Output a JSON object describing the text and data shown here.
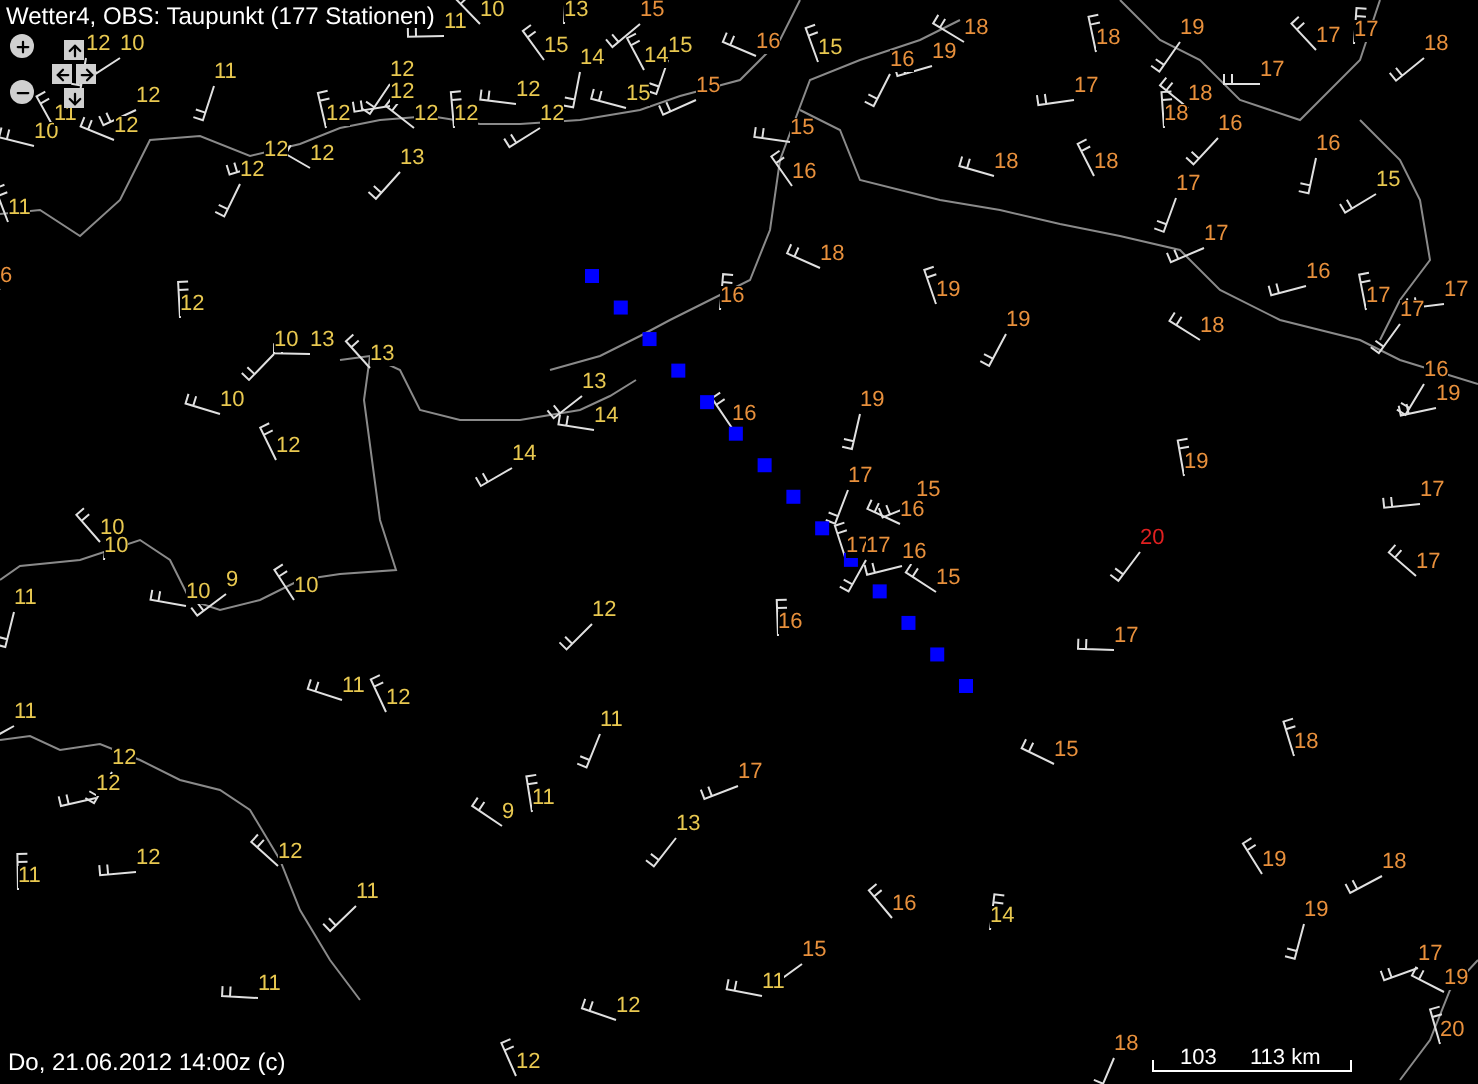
{
  "title": "Wetter4, OBS: Taupunkt (177 Stationen)",
  "stations": [
    {
      "value": "12",
      "color": "#e8c850"
    },
    {
      "value": "10",
      "color": "#e8c850"
    },
    {
      "value": "10",
      "color": "#e8c850"
    },
    {
      "value": "11",
      "color": "#e8c850"
    },
    {
      "value": "11",
      "color": "#e8c850"
    },
    {
      "value": "12",
      "color": "#e8c850"
    },
    {
      "value": "12",
      "color": "#e8c850"
    },
    {
      "value": "11",
      "color": "#e8c850"
    },
    {
      "value": "12",
      "color": "#e8c850"
    },
    {
      "value": "12",
      "color": "#e8c850"
    },
    {
      "value": "12",
      "color": "#e8c850"
    },
    {
      "value": "12",
      "color": "#e8c850"
    },
    {
      "value": "12",
      "color": "#e8c850"
    },
    {
      "value": "12",
      "color": "#e8c850"
    },
    {
      "value": "12",
      "color": "#e8c850"
    },
    {
      "value": "12",
      "color": "#e8c850"
    },
    {
      "value": "13",
      "color": "#e8c850"
    },
    {
      "value": "11",
      "color": "#e8c850"
    },
    {
      "value": "10",
      "color": "#e8c850"
    },
    {
      "value": "13",
      "color": "#e8c850"
    },
    {
      "value": "15",
      "color": "#e8903c"
    },
    {
      "value": "12",
      "color": "#e8c850"
    },
    {
      "value": "15",
      "color": "#e8c850"
    },
    {
      "value": "14",
      "color": "#e8c850"
    },
    {
      "value": "12",
      "color": "#e8c850"
    },
    {
      "value": "15",
      "color": "#e8c850"
    },
    {
      "value": "14",
      "color": "#e8c850"
    },
    {
      "value": "15",
      "color": "#e8c850"
    },
    {
      "value": "15",
      "color": "#e8903c"
    },
    {
      "value": "16",
      "color": "#e8903c"
    },
    {
      "value": "15",
      "color": "#e8c850"
    },
    {
      "value": "16",
      "color": "#e8903c"
    },
    {
      "value": "19",
      "color": "#e8903c"
    },
    {
      "value": "18",
      "color": "#e8903c"
    },
    {
      "value": "18",
      "color": "#e8903c"
    },
    {
      "value": "19",
      "color": "#e8903c"
    },
    {
      "value": "17",
      "color": "#e8903c"
    },
    {
      "value": "18",
      "color": "#e8903c"
    },
    {
      "value": "18",
      "color": "#e8903c"
    },
    {
      "value": "16",
      "color": "#e8903c"
    },
    {
      "value": "17",
      "color": "#e8903c"
    },
    {
      "value": "17",
      "color": "#e8903c"
    },
    {
      "value": "17",
      "color": "#e8903c"
    },
    {
      "value": "18",
      "color": "#e8903c"
    },
    {
      "value": "15",
      "color": "#e8903c"
    },
    {
      "value": "16",
      "color": "#e8903c"
    },
    {
      "value": "16",
      "color": "#e8903c"
    },
    {
      "value": "15",
      "color": "#e8c850"
    },
    {
      "value": "18",
      "color": "#e8903c"
    },
    {
      "value": "18",
      "color": "#e8903c"
    },
    {
      "value": "17",
      "color": "#e8903c"
    },
    {
      "value": "17",
      "color": "#e8903c"
    },
    {
      "value": "18",
      "color": "#e8903c"
    },
    {
      "value": "19",
      "color": "#e8903c"
    },
    {
      "value": "19",
      "color": "#e8903c"
    },
    {
      "value": "16",
      "color": "#e8903c"
    },
    {
      "value": "18",
      "color": "#e8903c"
    },
    {
      "value": "17",
      "color": "#e8903c"
    },
    {
      "value": "17",
      "color": "#e8903c"
    },
    {
      "value": "17",
      "color": "#e8903c"
    },
    {
      "value": "6",
      "color": "#e8903c"
    },
    {
      "value": "12",
      "color": "#e8c850"
    },
    {
      "value": "10",
      "color": "#e8c850"
    },
    {
      "value": "13",
      "color": "#e8c850"
    },
    {
      "value": "13",
      "color": "#e8c850"
    },
    {
      "value": "16",
      "color": "#e8903c"
    },
    {
      "value": "13",
      "color": "#e8c850"
    },
    {
      "value": "14",
      "color": "#e8c850"
    },
    {
      "value": "16",
      "color": "#e8903c"
    },
    {
      "value": "19",
      "color": "#e8903c"
    },
    {
      "value": "14",
      "color": "#e8c850"
    },
    {
      "value": "10",
      "color": "#e8c850"
    },
    {
      "value": "12",
      "color": "#e8c850"
    },
    {
      "value": "17",
      "color": "#e8903c"
    },
    {
      "value": "15",
      "color": "#e8903c"
    },
    {
      "value": "16",
      "color": "#e8903c"
    },
    {
      "value": "17",
      "color": "#e8903c"
    },
    {
      "value": "17",
      "color": "#e8903c"
    },
    {
      "value": "16",
      "color": "#e8903c"
    },
    {
      "value": "15",
      "color": "#e8903c"
    },
    {
      "value": "19",
      "color": "#e8903c"
    },
    {
      "value": "20",
      "color": "#e02020"
    },
    {
      "value": "17",
      "color": "#e8903c"
    },
    {
      "value": "17",
      "color": "#e8903c"
    },
    {
      "value": "16",
      "color": "#e8903c"
    },
    {
      "value": "12",
      "color": "#e8c850"
    },
    {
      "value": "17",
      "color": "#e8903c"
    },
    {
      "value": "10",
      "color": "#e8c850"
    },
    {
      "value": "10",
      "color": "#e8c850"
    },
    {
      "value": "9",
      "color": "#e8c850"
    },
    {
      "value": "10",
      "color": "#e8c850"
    },
    {
      "value": "10",
      "color": "#e8c850"
    },
    {
      "value": "11",
      "color": "#e8c850"
    },
    {
      "value": "11",
      "color": "#e8c850"
    },
    {
      "value": "11",
      "color": "#e8c850"
    },
    {
      "value": "12",
      "color": "#e8c850"
    },
    {
      "value": "11",
      "color": "#e8c850"
    },
    {
      "value": "17",
      "color": "#e8903c"
    },
    {
      "value": "15",
      "color": "#e8903c"
    },
    {
      "value": "18",
      "color": "#e8903c"
    },
    {
      "value": "12",
      "color": "#e8c850"
    },
    {
      "value": "12",
      "color": "#e8c850"
    },
    {
      "value": "9",
      "color": "#e8c850"
    },
    {
      "value": "11",
      "color": "#e8c850"
    },
    {
      "value": "13",
      "color": "#e8c850"
    },
    {
      "value": "12",
      "color": "#e8c850"
    },
    {
      "value": "12",
      "color": "#e8c850"
    },
    {
      "value": "11",
      "color": "#e8c850"
    },
    {
      "value": "11",
      "color": "#e8c850"
    },
    {
      "value": "11",
      "color": "#e8c850"
    },
    {
      "value": "16",
      "color": "#e8903c"
    },
    {
      "value": "14",
      "color": "#e8c850"
    },
    {
      "value": "15",
      "color": "#e8903c"
    },
    {
      "value": "11",
      "color": "#e8c850"
    },
    {
      "value": "19",
      "color": "#e8903c"
    },
    {
      "value": "19",
      "color": "#e8903c"
    },
    {
      "value": "18",
      "color": "#e8903c"
    },
    {
      "value": "12",
      "color": "#e8c850"
    },
    {
      "value": "12",
      "color": "#e8c850"
    },
    {
      "value": "18",
      "color": "#e8903c"
    },
    {
      "value": "17",
      "color": "#e8903c"
    },
    {
      "value": "19",
      "color": "#e8903c"
    },
    {
      "value": "20",
      "color": "#e8903c"
    },
    {
      "value": "16",
      "color": "#e8903c"
    },
    {
      "value": "19",
      "color": "#e8903c"
    }
  ],
  "timestamp": "Do, 21.06.2012 14:00z (c)",
  "scale": {
    "start": "103",
    "end": "113 km"
  }
}
